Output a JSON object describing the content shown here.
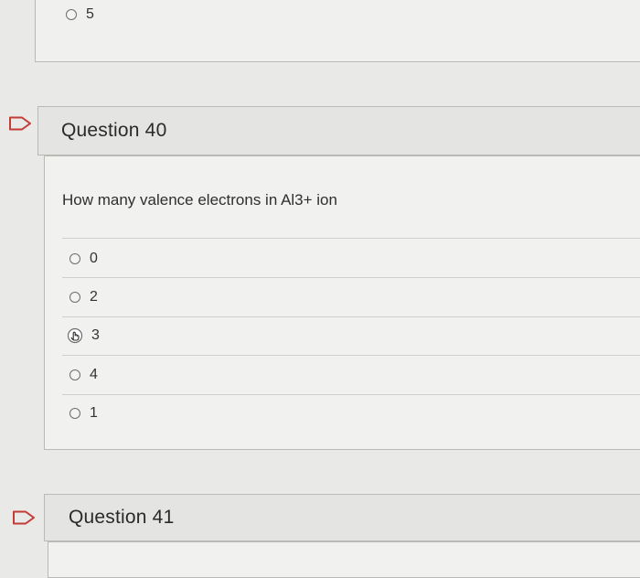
{
  "previous_question": {
    "last_option": "5"
  },
  "question40": {
    "title": "Question 40",
    "prompt": "How many valence electrons in Al3+ ion",
    "options": [
      "0",
      "2",
      "3",
      "4",
      "1"
    ],
    "selected_option": "3"
  },
  "question41": {
    "title": "Question 41"
  },
  "icons": {
    "flag": "flag-outline-icon",
    "pointer": "hand-pointer-icon"
  },
  "colors": {
    "page_background": "#e9e9e7",
    "card_background": "#f0f0ee",
    "header_background": "#e4e4e2",
    "flag_red": "#c43a35"
  }
}
